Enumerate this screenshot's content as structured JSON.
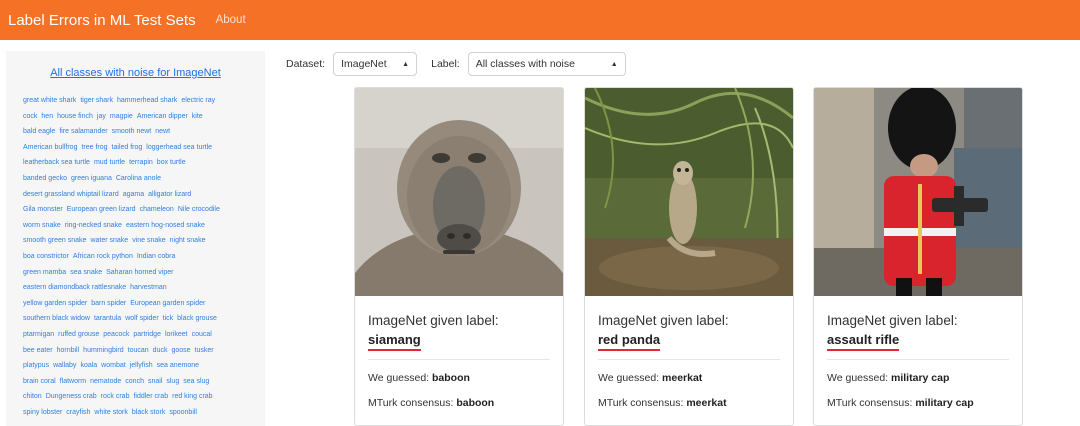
{
  "navbar": {
    "brand": "Label Errors in ML Test Sets",
    "about": "About"
  },
  "sidebar": {
    "title": "All classes with noise for ImageNet",
    "rows": [
      [
        "great white shark",
        "tiger shark",
        "hammerhead shark",
        "electric ray"
      ],
      [
        "cock",
        "hen",
        "house finch",
        "jay",
        "magpie",
        "American dipper",
        "kite"
      ],
      [
        "bald eagle",
        "fire salamander",
        "smooth newt",
        "newt"
      ],
      [
        "American bullfrog",
        "tree frog",
        "tailed frog",
        "loggerhead sea turtle"
      ],
      [
        "leatherback sea turtle",
        "mud turtle",
        "terrapin",
        "box turtle"
      ],
      [
        "banded gecko",
        "green iguana",
        "Carolina anole"
      ],
      [
        "desert grassland whiptail lizard",
        "agama",
        "alligator lizard"
      ],
      [
        "Gila monster",
        "European green lizard",
        "chameleon",
        "Nile crocodile"
      ],
      [
        "worm snake",
        "ring-necked snake",
        "eastern hog-nosed snake"
      ],
      [
        "smooth green snake",
        "water snake",
        "vine snake",
        "night snake"
      ],
      [
        "boa constrictor",
        "African rock python",
        "Indian cobra"
      ],
      [
        "green mamba",
        "sea snake",
        "Saharan horned viper"
      ],
      [
        "eastern diamondback rattlesnake",
        "harvestman"
      ],
      [
        "yellow garden spider",
        "barn spider",
        "European garden spider"
      ],
      [
        "southern black widow",
        "tarantula",
        "wolf spider",
        "tick",
        "black grouse"
      ],
      [
        "ptarmigan",
        "ruffed grouse",
        "peacock",
        "partridge",
        "lorikeet",
        "coucal"
      ],
      [
        "bee eater",
        "hornbill",
        "hummingbird",
        "toucan",
        "duck",
        "goose",
        "tusker"
      ],
      [
        "platypus",
        "wallaby",
        "koala",
        "wombat",
        "jellyfish",
        "sea anemone"
      ],
      [
        "brain coral",
        "flatworm",
        "nematode",
        "conch",
        "snail",
        "slug",
        "sea slug"
      ],
      [
        "chiton",
        "Dungeness crab",
        "rock crab",
        "fiddler crab",
        "red king crab"
      ],
      [
        "spiny lobster",
        "crayfish",
        "white stork",
        "black stork",
        "spoonbill"
      ]
    ]
  },
  "controls": {
    "dataset_label": "Dataset:",
    "dataset_value": "ImageNet",
    "label_label": "Label:",
    "label_value": "All classes with noise"
  },
  "cards": [
    {
      "given_text": "ImageNet given label:",
      "given_label": "siamang",
      "guess_prefix": "We guessed: ",
      "guess": "baboon",
      "mturk_prefix": "MTurk consensus: ",
      "mturk": "baboon"
    },
    {
      "given_text": "ImageNet given label:",
      "given_label": "red panda",
      "guess_prefix": "We guessed: ",
      "guess": "meerkat",
      "mturk_prefix": "MTurk consensus: ",
      "mturk": "meerkat"
    },
    {
      "given_text": "ImageNet given label:",
      "given_label": "assault rifle",
      "guess_prefix": "We guessed: ",
      "guess": "military cap",
      "mturk_prefix": "MTurk consensus: ",
      "mturk": "military cap"
    }
  ]
}
